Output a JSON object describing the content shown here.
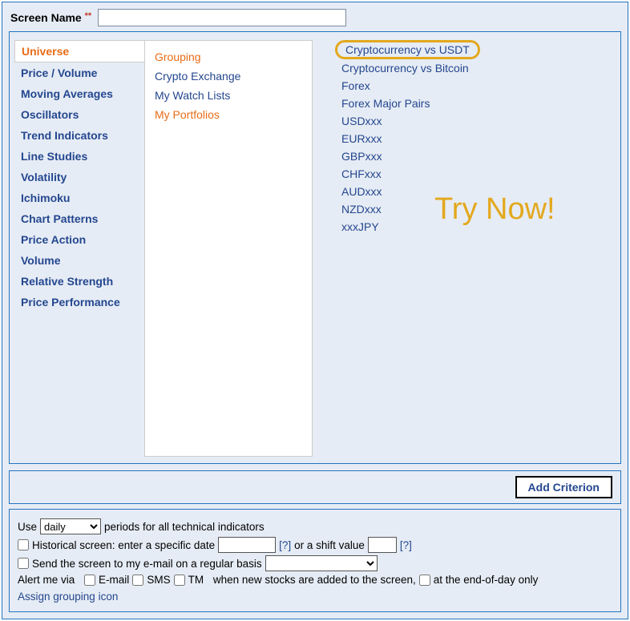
{
  "header": {
    "screen_name_label": "Screen Name",
    "required_mark": "**",
    "screen_name_value": ""
  },
  "categories": [
    {
      "label": "Universe",
      "selected": true
    },
    {
      "label": "Price / Volume"
    },
    {
      "label": "Moving Averages"
    },
    {
      "label": "Oscillators"
    },
    {
      "label": "Trend Indicators"
    },
    {
      "label": "Line Studies"
    },
    {
      "label": "Volatility"
    },
    {
      "label": "Ichimoku"
    },
    {
      "label": "Chart Patterns"
    },
    {
      "label": "Price Action"
    },
    {
      "label": "Volume"
    },
    {
      "label": "Relative Strength"
    },
    {
      "label": "Price Performance"
    }
  ],
  "groups": [
    {
      "label": "Grouping",
      "orange": true
    },
    {
      "label": "Crypto Exchange"
    },
    {
      "label": "My Watch Lists"
    },
    {
      "label": "My Portfolios",
      "orange": true
    }
  ],
  "options": [
    {
      "label": "Cryptocurrency vs USDT",
      "highlight": true
    },
    {
      "label": "Cryptocurrency vs Bitcoin"
    },
    {
      "label": "Forex"
    },
    {
      "label": "Forex Major Pairs"
    },
    {
      "label": "USDxxx"
    },
    {
      "label": "EURxxx"
    },
    {
      "label": "GBPxxx"
    },
    {
      "label": "CHFxxx"
    },
    {
      "label": "AUDxxx"
    },
    {
      "label": "NZDxxx"
    },
    {
      "label": "xxxJPY"
    }
  ],
  "callout": "Try Now!",
  "add_criterion_label": "Add Criterion",
  "settings": {
    "use_prefix": "Use",
    "period_value": "daily",
    "use_suffix": "periods for all technical indicators",
    "hist_label": "Historical screen: enter a specific date",
    "hist_date_value": "",
    "help_symbol": "[?]",
    "hist_mid": "or a shift value",
    "hist_shift_value": "",
    "send_label": "Send the screen to my e-mail on a regular basis",
    "alert_prefix": "Alert me via",
    "alert_email": "E-mail",
    "alert_sms": "SMS",
    "alert_tm": "TM",
    "alert_mid": "when new stocks are added to the screen,",
    "alert_eod": "at the end-of-day only",
    "assign_icon": "Assign grouping icon"
  }
}
